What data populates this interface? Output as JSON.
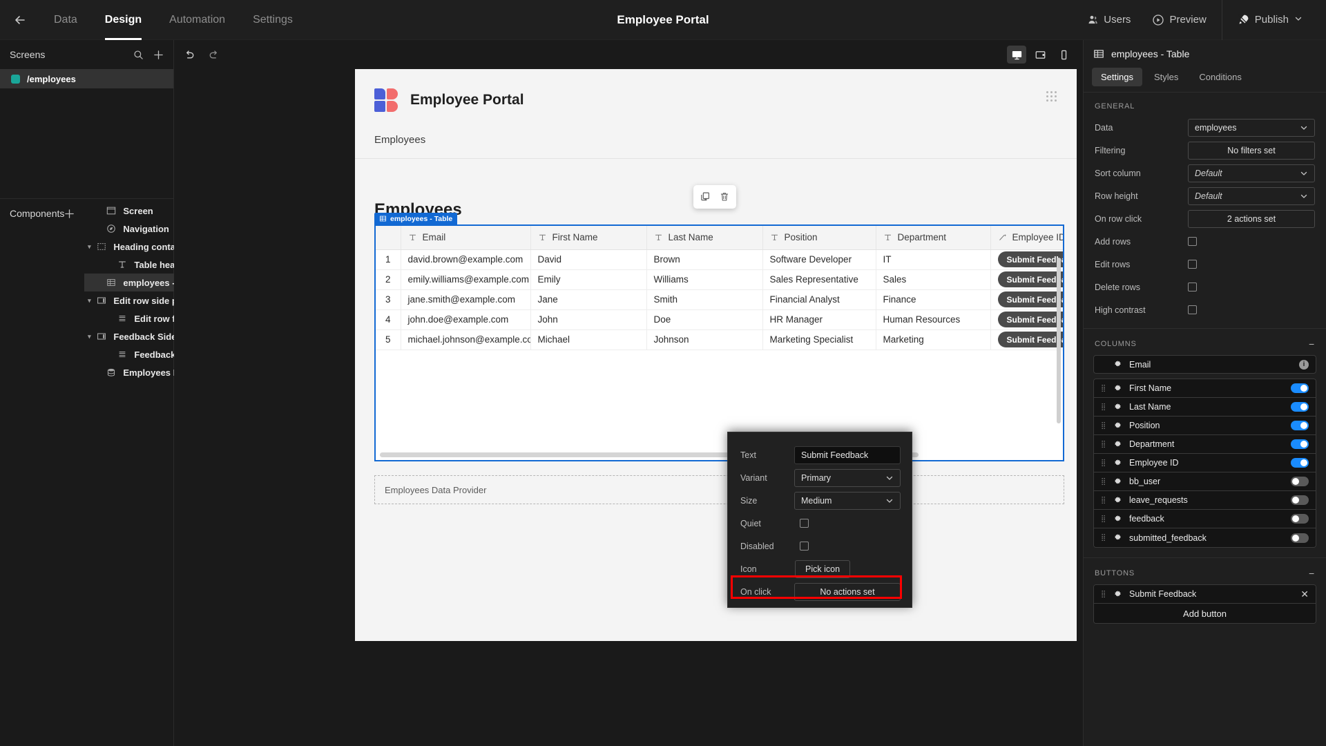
{
  "topbar": {
    "back_icon": "arrow-left-icon",
    "tabs": [
      {
        "label": "Data",
        "active": false
      },
      {
        "label": "Design",
        "active": true
      },
      {
        "label": "Automation",
        "active": false
      },
      {
        "label": "Settings",
        "active": false
      }
    ],
    "app_title": "Employee Portal",
    "users_label": "Users",
    "preview_label": "Preview",
    "publish_label": "Publish"
  },
  "screens_panel": {
    "title": "Screens",
    "items": [
      {
        "label": "/employees",
        "color": "#1aa699",
        "selected": true
      }
    ]
  },
  "components_panel": {
    "title": "Components",
    "items": [
      {
        "label": "Screen",
        "icon": "screen-icon",
        "indent": 0,
        "caret": "",
        "selected": false,
        "dots": false
      },
      {
        "label": "Navigation",
        "icon": "navigation-icon",
        "indent": 0,
        "caret": "",
        "selected": false,
        "dots": false
      },
      {
        "label": "Heading container",
        "icon": "container-icon",
        "indent": 0,
        "caret": "down",
        "selected": false,
        "dots": false
      },
      {
        "label": "Table heading",
        "icon": "text-icon",
        "indent": 1,
        "caret": "",
        "selected": false,
        "dots": false
      },
      {
        "label": "employees - Table",
        "icon": "table-icon",
        "indent": 0,
        "caret": "",
        "selected": true,
        "dots": true
      },
      {
        "label": "Edit row side panel",
        "icon": "sidepanel-icon",
        "indent": 0,
        "caret": "down",
        "selected": false,
        "dots": false
      },
      {
        "label": "Edit row form block",
        "icon": "form-icon",
        "indent": 1,
        "caret": "",
        "selected": false,
        "dots": false
      },
      {
        "label": "Feedback Side Panel",
        "icon": "sidepanel-icon",
        "indent": 0,
        "caret": "down",
        "selected": false,
        "dots": false
      },
      {
        "label": "Feedback Form Block",
        "icon": "form-icon",
        "indent": 1,
        "caret": "",
        "selected": false,
        "dots": false
      },
      {
        "label": "Employees Data Provider",
        "icon": "database-icon",
        "indent": 0,
        "caret": "",
        "selected": false,
        "dots": false
      }
    ]
  },
  "canvas": {
    "undo_icon": "undo-icon",
    "redo_icon": "redo-icon",
    "devices": [
      {
        "name": "desktop-icon",
        "active": true
      },
      {
        "name": "tablet-icon",
        "active": false
      },
      {
        "name": "mobile-icon",
        "active": false
      }
    ],
    "portal_title": "Employee Portal",
    "nav_item": "Employees",
    "table_heading": "Employees",
    "selection_badge": "employees - Table",
    "float_toolbar": [
      {
        "name": "duplicate-icon"
      },
      {
        "name": "delete-icon"
      }
    ],
    "data_provider_label": "Employees Data Provider",
    "table": {
      "columns": [
        {
          "label": "Email",
          "icon": "text-type-icon"
        },
        {
          "label": "First Name",
          "icon": "text-type-icon"
        },
        {
          "label": "Last Name",
          "icon": "text-type-icon"
        },
        {
          "label": "Position",
          "icon": "text-type-icon"
        },
        {
          "label": "Department",
          "icon": "text-type-icon"
        },
        {
          "label": "Employee ID",
          "icon": "formula-icon"
        }
      ],
      "rows": [
        {
          "num": "1",
          "email": "david.brown@example.com",
          "first": "David",
          "last": "Brown",
          "position": "Software Developer",
          "department": "IT",
          "button": "Submit Feedback"
        },
        {
          "num": "2",
          "email": "emily.williams@example.com",
          "first": "Emily",
          "last": "Williams",
          "position": "Sales Representative",
          "department": "Sales",
          "button": "Submit Feedback"
        },
        {
          "num": "3",
          "email": "jane.smith@example.com",
          "first": "Jane",
          "last": "Smith",
          "position": "Financial Analyst",
          "department": "Finance",
          "button": "Submit Feedback"
        },
        {
          "num": "4",
          "email": "john.doe@example.com",
          "first": "John",
          "last": "Doe",
          "position": "HR Manager",
          "department": "Human Resources",
          "button": "Submit Feedback"
        },
        {
          "num": "5",
          "email": "michael.johnson@example.con",
          "first": "Michael",
          "last": "Johnson",
          "position": "Marketing Specialist",
          "department": "Marketing",
          "button": "Submit Feedback"
        }
      ]
    }
  },
  "popover": {
    "rows": [
      {
        "label": "Text",
        "type": "input",
        "value": "Submit Feedback"
      },
      {
        "label": "Variant",
        "type": "select",
        "value": "Primary"
      },
      {
        "label": "Size",
        "type": "select",
        "value": "Medium"
      },
      {
        "label": "Quiet",
        "type": "checkbox",
        "value": ""
      },
      {
        "label": "Disabled",
        "type": "checkbox",
        "value": ""
      },
      {
        "label": "Icon",
        "type": "button",
        "value": "Pick icon"
      },
      {
        "label": "On click",
        "type": "button-wide",
        "value": "No actions set"
      }
    ],
    "highlight_color": "#ff0000"
  },
  "right_panel": {
    "title": "employees - Table",
    "title_icon": "table-icon",
    "tabs": [
      {
        "label": "Settings",
        "active": true
      },
      {
        "label": "Styles",
        "active": false
      },
      {
        "label": "Conditions",
        "active": false
      }
    ],
    "general": {
      "section_label": "GENERAL",
      "rows": [
        {
          "label": "Data",
          "type": "select",
          "value": "employees",
          "italic": false
        },
        {
          "label": "Filtering",
          "type": "button",
          "value": "No filters set"
        },
        {
          "label": "Sort column",
          "type": "select",
          "value": "Default",
          "italic": true
        },
        {
          "label": "Row height",
          "type": "select",
          "value": "Default",
          "italic": true
        },
        {
          "label": "On row click",
          "type": "button",
          "value": "2 actions set"
        },
        {
          "label": "Add rows",
          "type": "checkbox",
          "value": ""
        },
        {
          "label": "Edit rows",
          "type": "checkbox",
          "value": ""
        },
        {
          "label": "Delete rows",
          "type": "checkbox",
          "value": ""
        },
        {
          "label": "High contrast",
          "type": "checkbox",
          "value": ""
        }
      ]
    },
    "columns": {
      "section_label": "COLUMNS",
      "primary": {
        "label": "Email",
        "tail": "info"
      },
      "items": [
        {
          "label": "First Name",
          "toggle": "on"
        },
        {
          "label": "Last Name",
          "toggle": "on"
        },
        {
          "label": "Position",
          "toggle": "on"
        },
        {
          "label": "Department",
          "toggle": "on"
        },
        {
          "label": "Employee ID",
          "toggle": "on"
        },
        {
          "label": "bb_user",
          "toggle": "off"
        },
        {
          "label": "leave_requests",
          "toggle": "off"
        },
        {
          "label": "feedback",
          "toggle": "off"
        },
        {
          "label": "submitted_feedback",
          "toggle": "off"
        }
      ]
    },
    "buttons": {
      "section_label": "BUTTONS",
      "items": [
        {
          "label": "Submit Feedback"
        }
      ],
      "add_label": "Add button"
    }
  }
}
